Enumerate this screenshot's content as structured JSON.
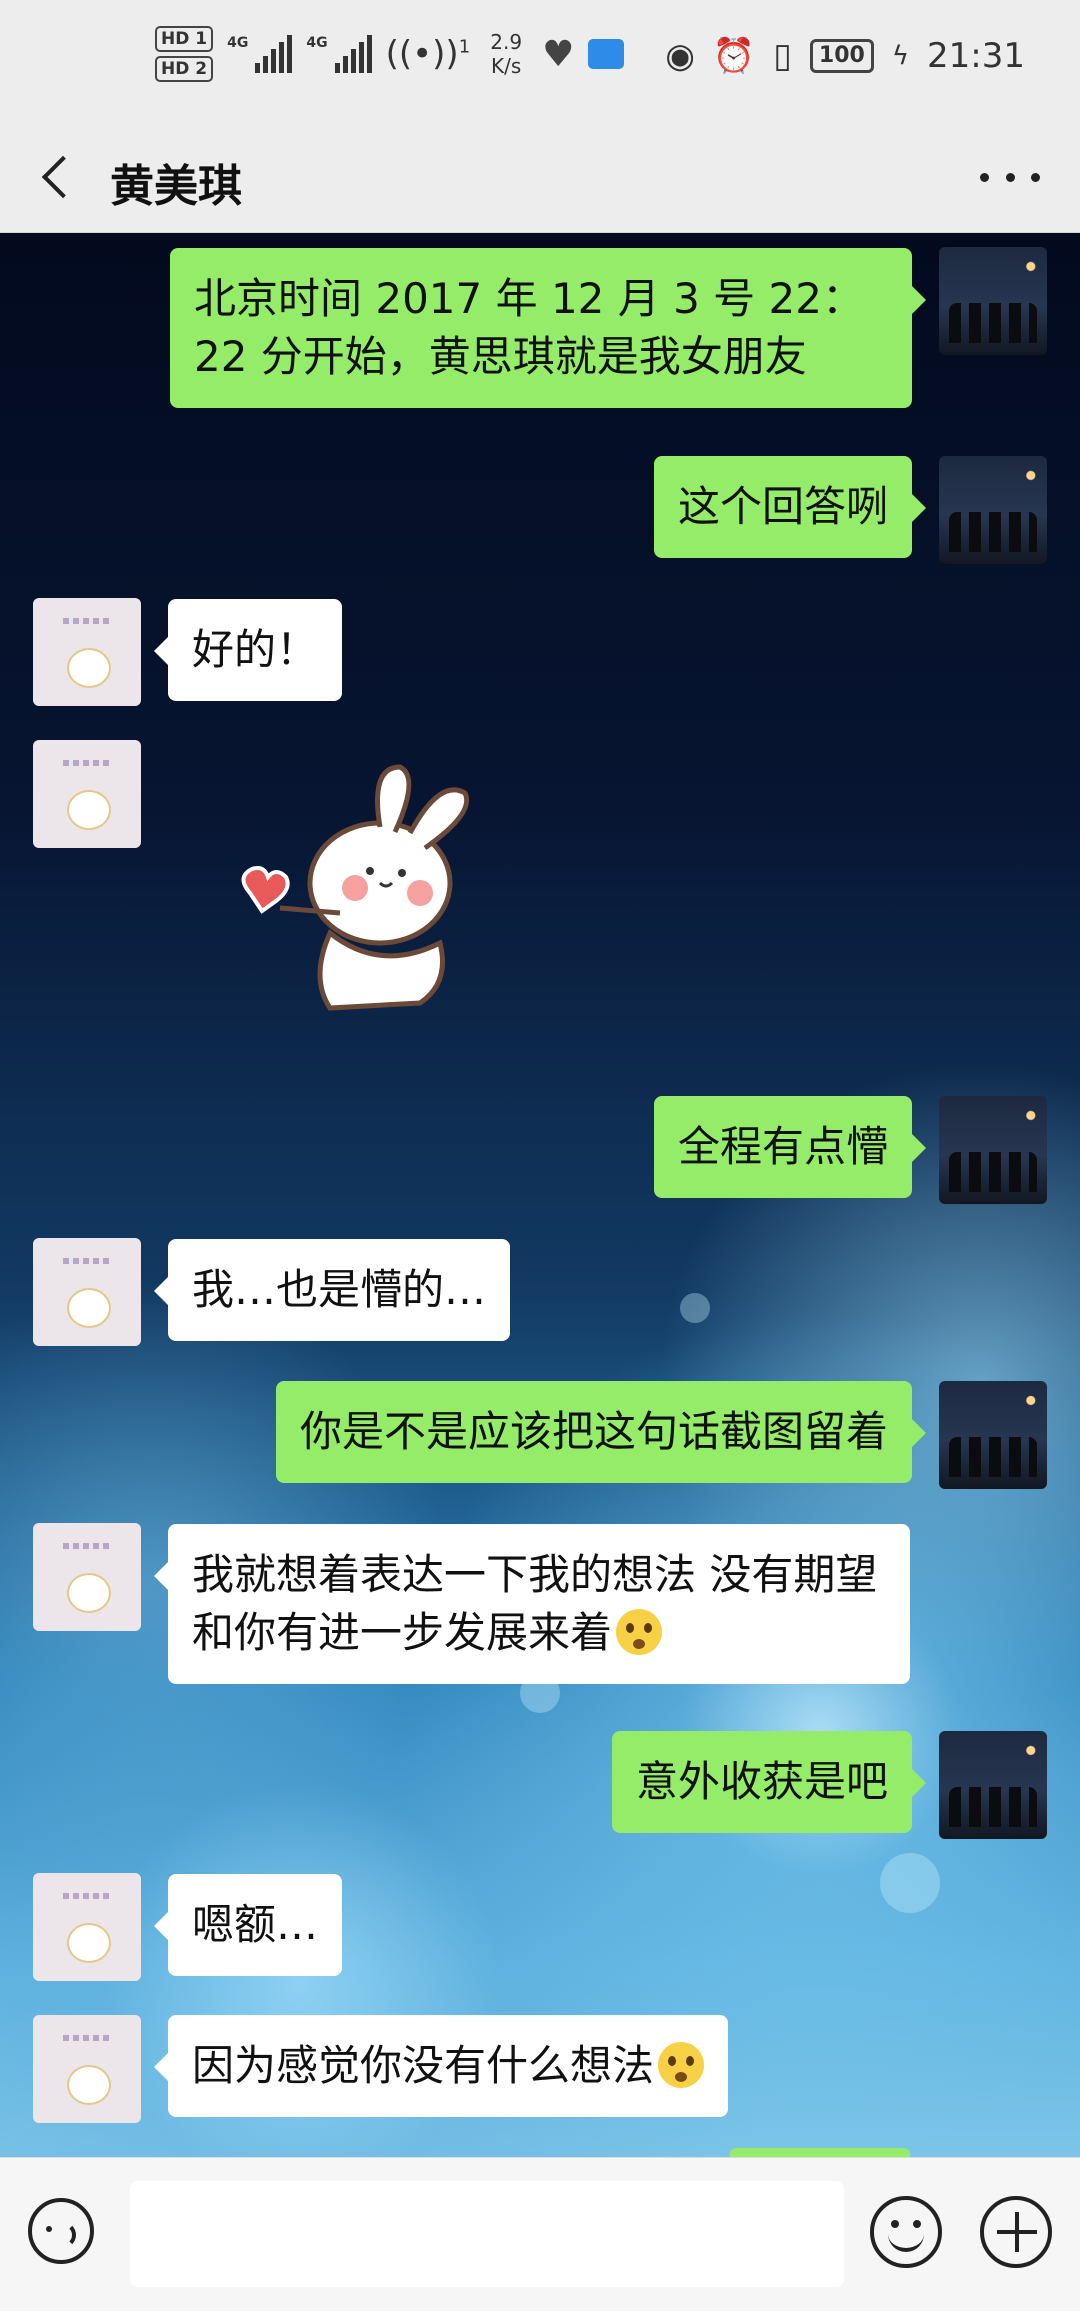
{
  "status_bar": {
    "hd1": "HD 1",
    "hd2": "HD 2",
    "net1": "4G",
    "net2": "4G",
    "hotspot_count": "1",
    "speed_value": "2.9",
    "speed_unit": "K/s",
    "battery": "100",
    "time": "21:31",
    "icons": [
      "eye-icon",
      "alarm-icon",
      "vibrate-icon",
      "battery-icon",
      "charging-icon",
      "heart-rate-icon",
      "app-notification-icon"
    ]
  },
  "header": {
    "title": "黄美琪",
    "back_icon": "chevron-left-icon",
    "more_icon": "more-dots-icon"
  },
  "messages": [
    {
      "from": "me",
      "text": "北京时间 2017 年 12 月 3 号 22：22 分开始，黄思琪就是我女朋友"
    },
    {
      "from": "me",
      "text": "这个回答咧"
    },
    {
      "from": "other",
      "text": "好的！"
    },
    {
      "from": "other",
      "type": "sticker",
      "sticker": "bunny-heart-sticker"
    },
    {
      "from": "me",
      "text": "全程有点懵"
    },
    {
      "from": "other",
      "text": "我…也是懵的…"
    },
    {
      "from": "me",
      "text": "你是不是应该把这句话截图留着"
    },
    {
      "from": "other",
      "text": "我就想着表达一下我的想法 没有期望和你有进一步发展来着",
      "emoji": "zipper-mouth-emoji"
    },
    {
      "from": "me",
      "text": "意外收获是吧"
    },
    {
      "from": "other",
      "text": "嗯额…"
    },
    {
      "from": "other",
      "text": "因为感觉你没有什么想法",
      "emoji": "flushed-emoji"
    }
  ],
  "input_bar": {
    "voice_icon": "voice-icon",
    "emoji_icon": "smile-icon",
    "plus_icon": "plus-icon",
    "value": ""
  },
  "colors": {
    "my_bubble": "#95ec69",
    "other_bubble": "#ffffff",
    "bar_bg": "#ededed"
  }
}
